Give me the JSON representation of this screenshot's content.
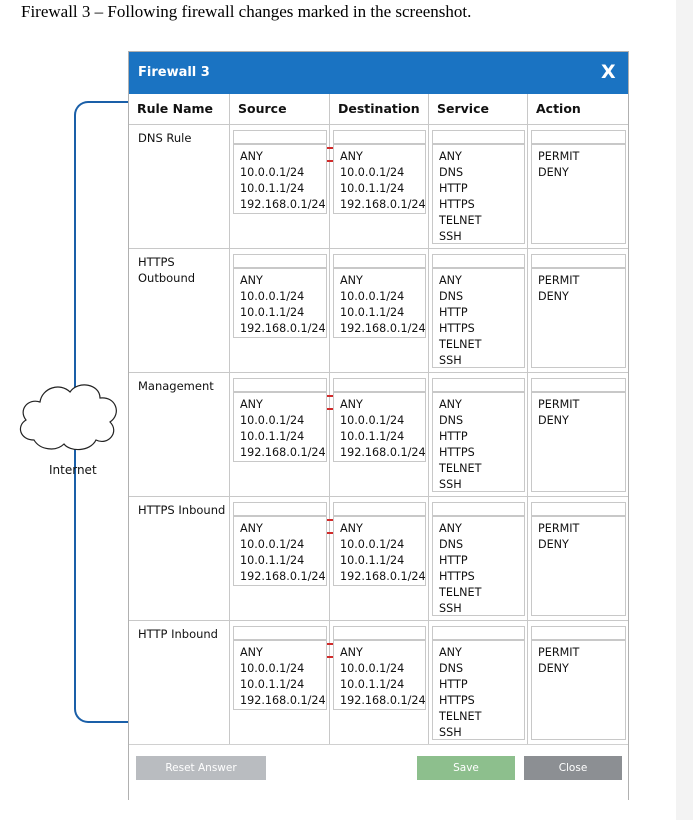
{
  "caption": "Firewall 3 – Following firewall changes marked in the screenshot.",
  "dialog": {
    "title": "Firewall 3",
    "close_label": "X"
  },
  "headers": {
    "rule_name": "Rule Name",
    "source": "Source",
    "destination": "Destination",
    "service": "Service",
    "action": "Action"
  },
  "address_options": [
    "ANY",
    "10.0.0.1/24",
    "10.0.1.1/24",
    "192.168.0.1/24"
  ],
  "service_options": [
    "ANY",
    "DNS",
    "HTTP",
    "HTTPS",
    "TELNET",
    "SSH"
  ],
  "action_options": [
    "PERMIT",
    "DENY"
  ],
  "rules": [
    {
      "name": "DNS Rule",
      "source": "ANY",
      "destination": "ANY",
      "service": "DNS",
      "action": "PERMIT"
    },
    {
      "name": "HTTPS\nOutbound",
      "source": "10.0.0.1/24",
      "destination": "ANY",
      "service": "HTTPS",
      "action": "PERMIT"
    },
    {
      "name": "Management",
      "source": "ANY",
      "destination": "ANY",
      "service": "SSH",
      "action": "PERMIT"
    },
    {
      "name": "HTTPS Inbound",
      "source": "ANY",
      "destination": "ANY",
      "service": "HTTPS",
      "action": "PERMIT"
    },
    {
      "name": "HTTP Inbound",
      "source": "ANY",
      "destination": "ANY",
      "service": "HTTP",
      "action": "DENY"
    }
  ],
  "buttons": {
    "reset": "Reset Answer",
    "save": "Save",
    "close": "Close"
  },
  "internet_label": "Internet",
  "colors": {
    "titlebar": "#1a73c2",
    "highlight": "#d12b2b",
    "reset_button": "#b9bcc0",
    "save_button": "#8dbf8d",
    "close_button": "#8c8f93",
    "link_line": "#1a5fa8"
  }
}
